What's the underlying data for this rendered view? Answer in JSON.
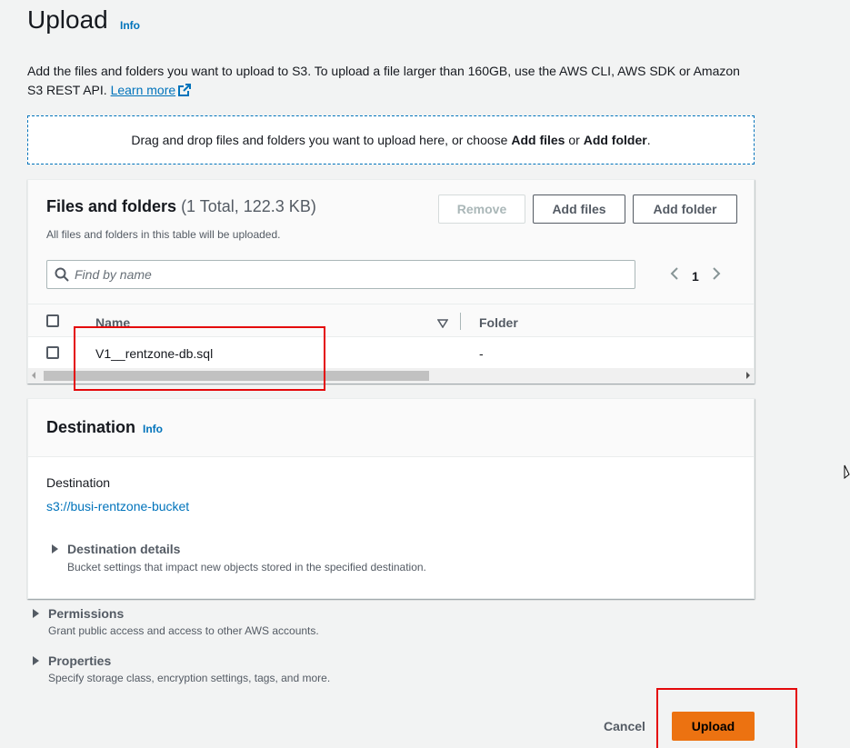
{
  "header": {
    "title": "Upload",
    "info": "Info",
    "description": "Add the files and folders you want to upload to S3. To upload a file larger than 160GB, use the AWS CLI, AWS SDK or Amazon S3 REST API.",
    "learn_more": "Learn more"
  },
  "dropzone": {
    "text_before": "Drag and drop files and folders you want to upload here, or choose ",
    "add_files": "Add files",
    "or": " or ",
    "add_folder": "Add folder",
    "period": "."
  },
  "files_panel": {
    "title": "Files and folders",
    "count": "(1 Total, 122.3 KB)",
    "subtitle": "All files and folders in this table will be uploaded.",
    "remove_label": "Remove",
    "add_files_label": "Add files",
    "add_folder_label": "Add folder",
    "search_placeholder": "Find by name",
    "page_number": "1",
    "columns": {
      "name": "Name",
      "folder": "Folder"
    },
    "rows": [
      {
        "name": "V1__rentzone-db.sql",
        "folder": "-"
      }
    ]
  },
  "destination_panel": {
    "title": "Destination",
    "info": "Info",
    "label": "Destination",
    "bucket": "s3://busi-rentzone-bucket",
    "details_title": "Destination details",
    "details_sub": "Bucket settings that impact new objects stored in the specified destination."
  },
  "permissions": {
    "title": "Permissions",
    "sub": "Grant public access and access to other AWS accounts."
  },
  "properties": {
    "title": "Properties",
    "sub": "Specify storage class, encryption settings, tags, and more."
  },
  "footer": {
    "cancel_label": "Cancel",
    "upload_label": "Upload"
  },
  "colors": {
    "link": "#0073bb",
    "primary_button": "#ec7211",
    "highlight": "#e4080a"
  },
  "icons": [
    "external-link-icon",
    "search-icon",
    "chevron-left-icon",
    "chevron-right-icon",
    "sort-icon",
    "caret-right-icon",
    "cursor-icon"
  ]
}
